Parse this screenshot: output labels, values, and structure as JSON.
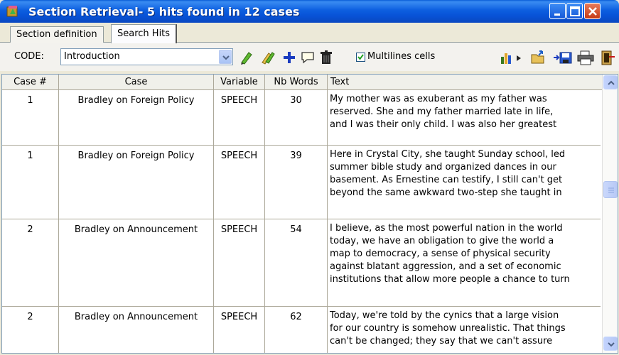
{
  "window": {
    "title": "Section Retrieval- 5 hits found in 12 cases"
  },
  "tabs": [
    {
      "label": "Section definition",
      "active": false
    },
    {
      "label": "Search Hits",
      "active": true
    }
  ],
  "toolbar": {
    "code_label": "CODE:",
    "code_value": "Introduction",
    "multilines_label": "Multilines cells",
    "multilines_checked": true
  },
  "grid": {
    "columns": [
      "Case #",
      "Case",
      "Variable",
      "Nb Words",
      "Text"
    ],
    "rows": [
      {
        "case_num": "1",
        "case": "Bradley on Foreign Policy",
        "variable": "SPEECH",
        "nb_words": "30",
        "text": "My mother was as exuberant as my father was\nreserved. She and my father married late in life,\nand I was their only child. I was also her greatest"
      },
      {
        "case_num": "1",
        "case": "Bradley on Foreign Policy",
        "variable": "SPEECH",
        "nb_words": "39",
        "text": "Here in Crystal City, she taught Sunday school, led\nsummer bible study and organized dances in our\nbasement. As Ernestine can testify, I still can't get\nbeyond the same awkward two-step she taught in"
      },
      {
        "case_num": "2",
        "case": "Bradley on Announcement",
        "variable": "SPEECH",
        "nb_words": "54",
        "text": "I believe, as the most powerful nation in the world\ntoday, we have an obligation to give the world a\nmap to democracy, a sense of physical security\nagainst blatant aggression, and a set of economic\ninstitutions that allow more people a chance to turn"
      },
      {
        "case_num": "2",
        "case": "Bradley on Announcement",
        "variable": "SPEECH",
        "nb_words": "62",
        "text": "Today, we're told by the cynics that a large vision\nfor our country is somehow unrealistic. That things\ncan't be changed; they say that we can't assure"
      }
    ]
  },
  "colors": {
    "titlebar": "#0a5ed8",
    "window_bg": "#ece9d8",
    "grid_border": "#aca899"
  }
}
